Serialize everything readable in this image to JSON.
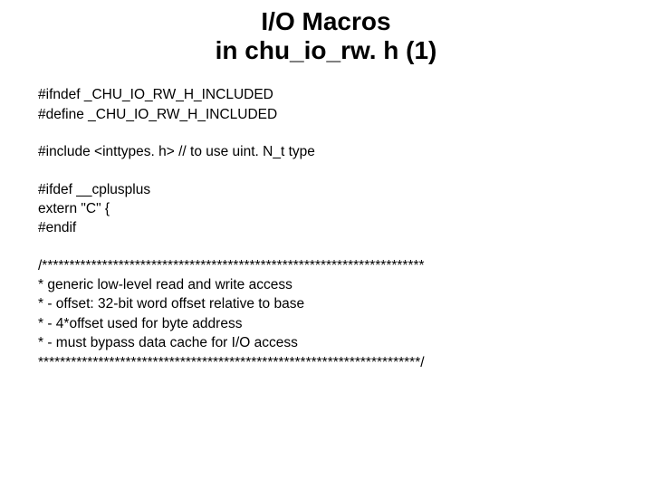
{
  "title": {
    "line1": "I/O Macros",
    "line2": "in chu_io_rw. h (1)"
  },
  "body": {
    "l1": "#ifndef _CHU_IO_RW_H_INCLUDED",
    "l2": "#define _CHU_IO_RW_H_INCLUDED",
    "l3": "#include <inttypes. h>    // to use uint. N_t type",
    "l4": "#ifdef __cplusplus",
    "l5": "extern \"C\" {",
    "l6": "#endif",
    "l7": "/**********************************************************************",
    "l8": "*  generic low-level read and write access",
    "l9": "*   - offset: 32-bit word offset relative to base",
    "l10": "*   - 4*offset used for byte address",
    "l11": "*   - must bypass data cache for I/O access",
    "l12": "**********************************************************************/"
  }
}
